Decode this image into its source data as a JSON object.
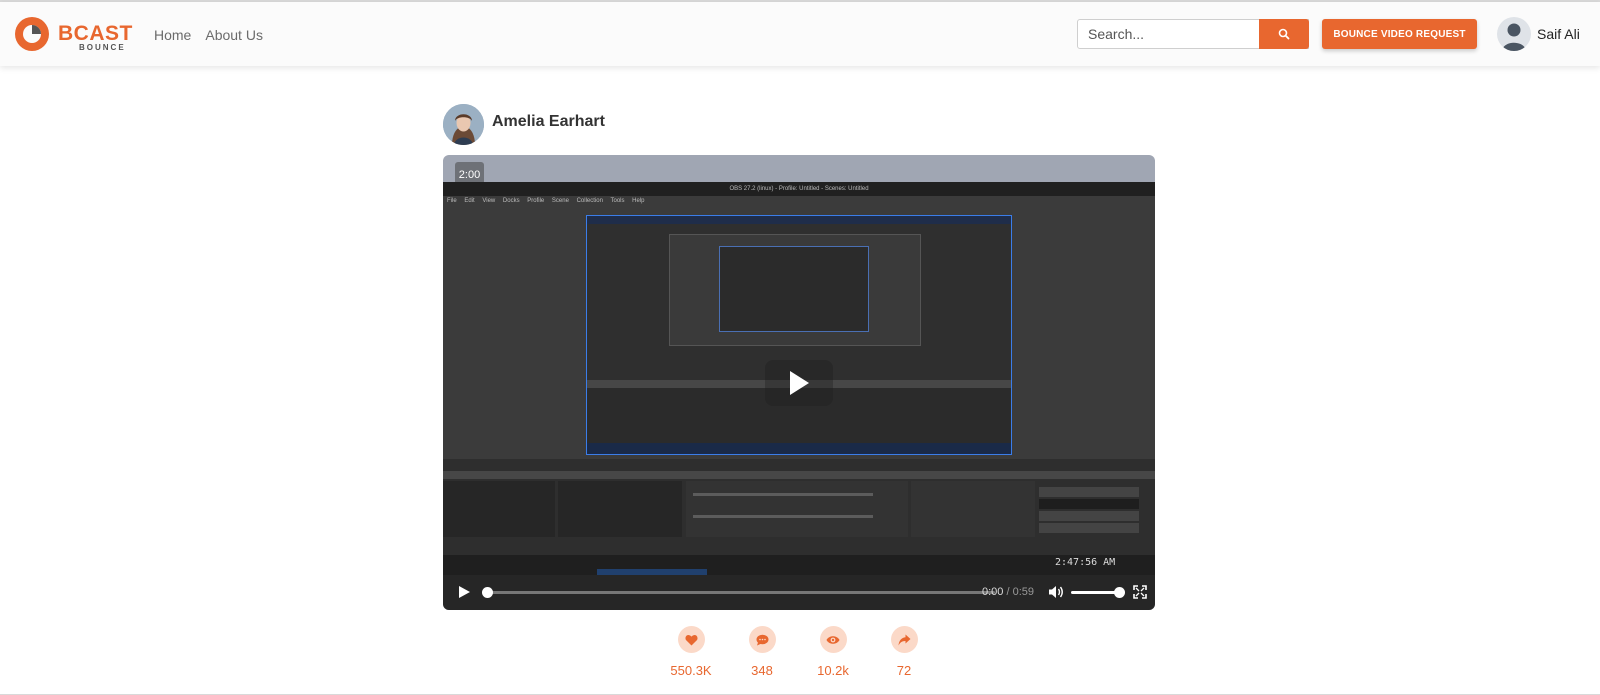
{
  "brand": {
    "logo_text": "BCAST",
    "logo_sub": "BOUNCE",
    "accent": "#e8672f"
  },
  "nav": {
    "items": [
      {
        "label": "Home"
      },
      {
        "label": "About Us"
      }
    ]
  },
  "search": {
    "placeholder": "Search...",
    "button_icon": "search-icon"
  },
  "header_actions": {
    "bounce_label": "BOUNCE VIDEO REQUEST",
    "user_name": "Saif Ali"
  },
  "post": {
    "author": "Amelia Earhart",
    "video": {
      "duration_badge": "2:00",
      "current_time": "0:00",
      "separator": "/",
      "total_time": "0:59",
      "progress_fraction": 0.0,
      "volume_fraction": 1.0,
      "obs_window_title": "OBS 27.2 (linux) - Profile: Untitled - Scenes: Untitled",
      "obs_menu": "File Edit View Docks Profile Scene Collection Tools Help",
      "obs_clock": "2:47:56 AM"
    },
    "stats": [
      {
        "name": "likes",
        "icon": "heart-icon",
        "count": "550.3K"
      },
      {
        "name": "comments",
        "icon": "comment-icon",
        "count": "348"
      },
      {
        "name": "views",
        "icon": "eye-icon",
        "count": "10.2k"
      },
      {
        "name": "shares",
        "icon": "share-icon",
        "count": "72"
      }
    ]
  }
}
